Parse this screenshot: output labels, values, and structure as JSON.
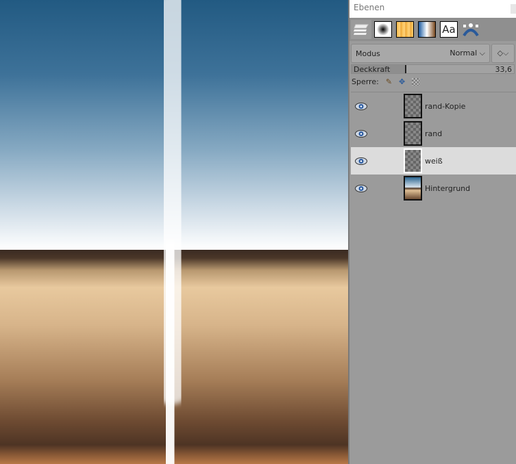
{
  "panel": {
    "title": "Ebenen",
    "tabs": [
      {
        "name": "layers"
      },
      {
        "name": "brushes"
      },
      {
        "name": "patterns"
      },
      {
        "name": "gradients"
      },
      {
        "name": "fonts",
        "label": "Aa"
      },
      {
        "name": "paths"
      }
    ],
    "mode_label": "Modus",
    "mode_value": "Normal",
    "opacity_label": "Deckkraft",
    "opacity_value": "33,6",
    "opacity_percent": 33.6,
    "lock_label": "Sperre:",
    "layers": [
      {
        "name": "rand-Kopie",
        "visible": true,
        "selected": false
      },
      {
        "name": "rand",
        "visible": true,
        "selected": false
      },
      {
        "name": "weiß",
        "visible": true,
        "selected": true
      },
      {
        "name": "Hintergrund",
        "visible": true,
        "selected": false
      }
    ]
  }
}
